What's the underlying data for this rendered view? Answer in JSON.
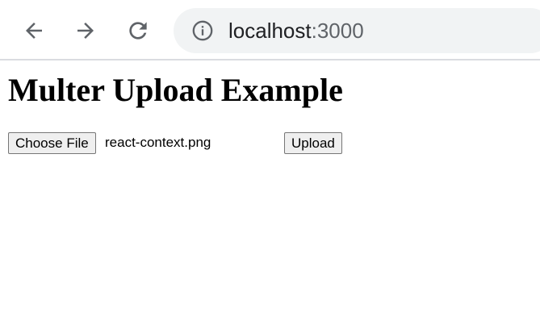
{
  "browser": {
    "icons": {
      "back": "arrow-left-icon",
      "forward": "arrow-right-icon",
      "reload": "reload-icon",
      "site_info": "info-circle-icon"
    },
    "url_host": "localhost",
    "url_port": ":3000",
    "colors": {
      "toolbar_bg": "#ffffff",
      "omnibox_bg": "#f1f3f4",
      "icon": "#5f6368",
      "url_text": "#202124",
      "url_muted": "#5f6368"
    }
  },
  "page": {
    "heading": "Multer Upload Example",
    "file_input": {
      "button_label": "Choose File",
      "selected_file": "react-context.png"
    },
    "upload_button_label": "Upload"
  }
}
